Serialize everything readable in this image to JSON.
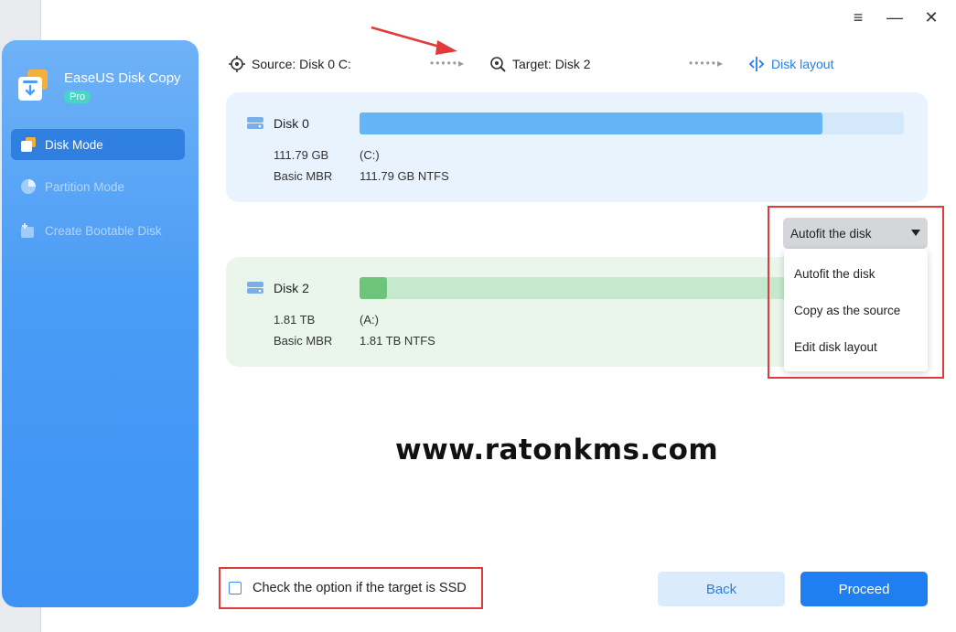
{
  "app": {
    "name": "EaseUS Disk Copy",
    "badge": "Pro"
  },
  "window_controls": {
    "menu": "≡",
    "minimize": "—",
    "close": "✕"
  },
  "sidebar": {
    "items": [
      {
        "label": "Disk Mode",
        "state": "active"
      },
      {
        "label": "Partition Mode",
        "state": "disabled"
      },
      {
        "label": "Create Bootable Disk",
        "state": "disabled"
      }
    ]
  },
  "steps": {
    "source": "Source: Disk 0 C:",
    "target": "Target: Disk 2",
    "layout": "Disk layout",
    "dots": "•••••"
  },
  "source_disk": {
    "name": "Disk 0",
    "size": "111.79 GB",
    "type": "Basic MBR",
    "partition_letter": "(C:)",
    "partition_info": "111.79 GB NTFS",
    "used_fraction": 0.85
  },
  "target_disk": {
    "name": "Disk 2",
    "size": "1.81 TB",
    "type": "Basic MBR",
    "partition_letter": "(A:)",
    "partition_info": "1.81 TB NTFS",
    "used_fraction": 0.05
  },
  "layout_dropdown": {
    "selected": "Autofit the disk",
    "options": [
      "Autofit the disk",
      "Copy as the source",
      "Edit disk layout"
    ]
  },
  "watermark": "www.ratonkms.com",
  "ssd_option": {
    "label": "Check the option if the target is SSD",
    "checked": false
  },
  "buttons": {
    "back": "Back",
    "proceed": "Proceed"
  },
  "colors": {
    "accent": "#1f7ef0",
    "source_bar": "#64b5f6",
    "target_bar": "#6cc57a",
    "highlight": "#e03a3a"
  }
}
